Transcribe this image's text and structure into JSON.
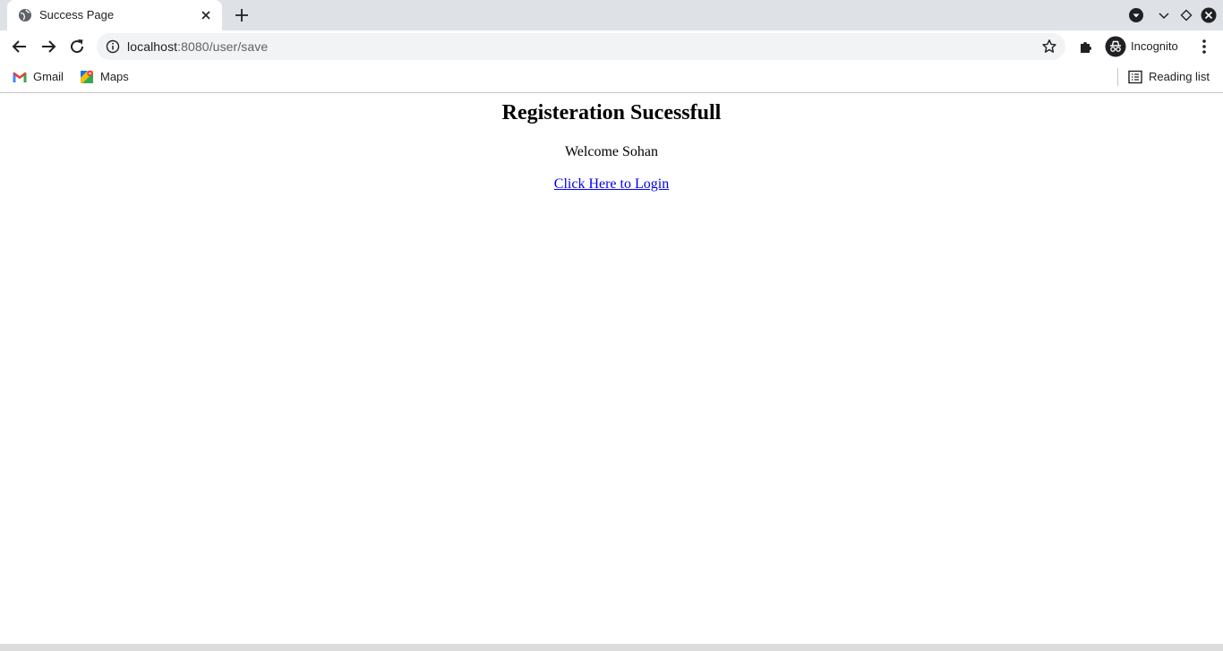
{
  "browser": {
    "tab": {
      "title": "Success Page"
    },
    "address_bar": {
      "host": "localhost",
      "rest": ":8080/user/save"
    },
    "profile": {
      "label": "Incognito"
    },
    "bookmarks": [
      {
        "label": "Gmail",
        "icon": "gmail-icon"
      },
      {
        "label": "Maps",
        "icon": "maps-icon"
      }
    ],
    "reading_list": {
      "label": "Reading list"
    }
  },
  "page": {
    "heading": "Registeration Sucessfull",
    "welcome": "Welcome Sohan",
    "login_link": "Click Here to Login"
  },
  "colors": {
    "tabstrip_bg": "#dee1e6",
    "link": "#0000ee",
    "omnibox_bg": "#f1f3f4"
  }
}
